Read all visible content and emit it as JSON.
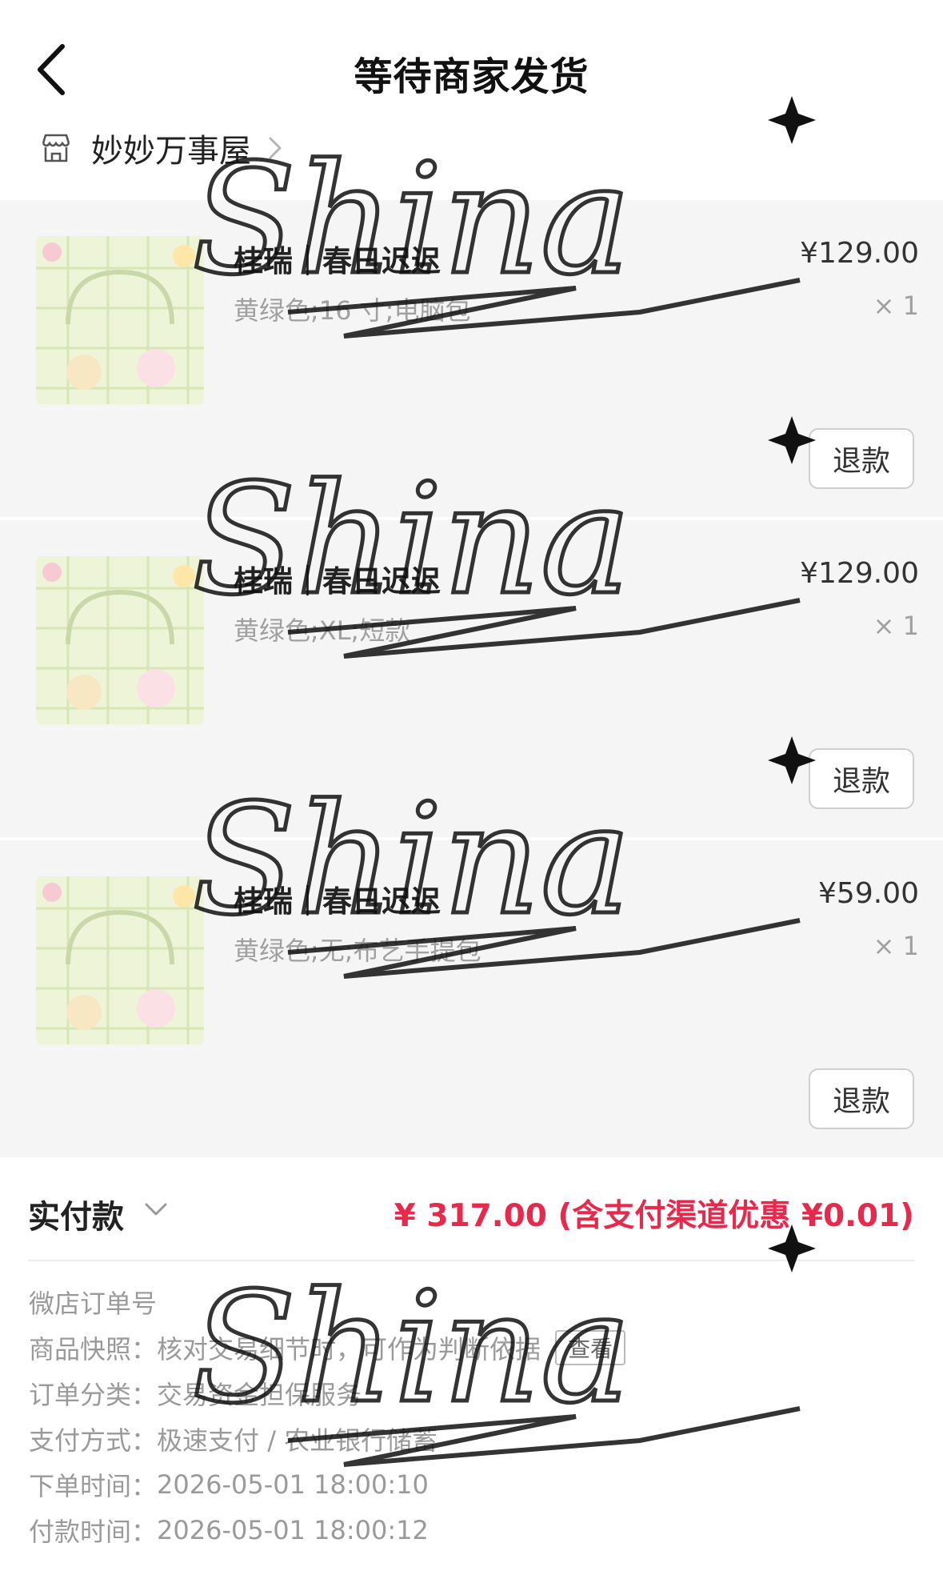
{
  "header": {
    "title": "等待商家发货"
  },
  "shop": {
    "name": "妙妙万事屋"
  },
  "items": [
    {
      "name": "桂瑞｜春日迟迟",
      "spec": "黄绿色;16 寸;电脑包",
      "price": "¥129.00",
      "qty": "× 1",
      "refund_label": "退款"
    },
    {
      "name": "桂瑞｜春日迟迟",
      "spec": "黄绿色;XL;短款",
      "price": "¥129.00",
      "qty": "× 1",
      "refund_label": "退款"
    },
    {
      "name": "桂瑞｜春日迟迟",
      "spec": "黄绿色;无;布艺手提包",
      "price": "¥59.00",
      "qty": "× 1",
      "refund_label": "退款"
    }
  ],
  "payment": {
    "label": "实付款",
    "amount": "¥ 317.00 (含支付渠道优惠 ¥0.01)"
  },
  "order_info": {
    "order_no_label": "微店订单号",
    "snapshot_label": "商品快照：",
    "snapshot_value": "核对交易细节时，可作为判断依据",
    "snapshot_button": "查看",
    "category_label": "订单分类：",
    "category_value": "交易资金担保服务",
    "method_label": "支付方式：",
    "method_value": "极速支付 / 农业银行储蓄",
    "order_time_label": "下单时间：",
    "order_time_value": "2026-05-01 18:00:10",
    "pay_time_label": "付款时间：",
    "pay_time_value": "2026-05-01 18:00:12"
  },
  "watermark": {
    "text": "Shina"
  },
  "colors": {
    "accent": "#e8294c",
    "item_bg": "#f5f5f6",
    "muted_text": "#9a9a9a"
  },
  "icons": {
    "back": "chevron-left-icon",
    "shop": "store-icon",
    "shop_chevron": "chevron-right-icon",
    "pay_chevron": "chevron-down-icon"
  }
}
